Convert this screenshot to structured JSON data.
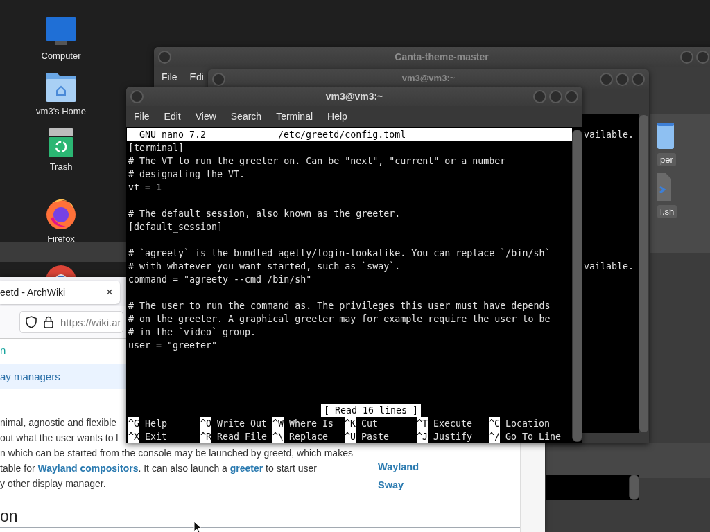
{
  "desktop_icons": [
    {
      "label": "Computer",
      "kind": "computer"
    },
    {
      "label": "vm3's Home",
      "kind": "home"
    },
    {
      "label": "Trash",
      "kind": "trash"
    },
    {
      "label": "Firefox",
      "kind": "firefox"
    },
    {
      "kind": "chrome"
    }
  ],
  "back_window": {
    "title": "Canta-theme-master",
    "menu": [
      "File",
      "Edi"
    ],
    "files": [
      {
        "label": "per",
        "kind": "folder"
      },
      {
        "label": "l.sh",
        "kind": "script"
      }
    ]
  },
  "middle_window": {
    "title": "vm3@vm3:~",
    "lines": [
      "vailable.",
      "vailable."
    ]
  },
  "browser": {
    "tab": {
      "title": "eetd - ArchWiki",
      "close": "×"
    },
    "url": "https://wiki.ar",
    "breadcrumb": "n",
    "category": "ay managers",
    "paragraph": [
      "nimal, agnostic and flexible",
      "out what the user wants to l",
      "n which can be started from the console may be launched by greetd, which makes",
      "table for **Wayland compositors**. It can also launch a **greeter** to start user",
      "y other display manager."
    ],
    "related": [
      "Wayland",
      "Sway"
    ],
    "heading": "on"
  },
  "terminal": {
    "title": "vm3@vm3:~",
    "menu": [
      "File",
      "Edit",
      "View",
      "Search",
      "Terminal",
      "Help"
    ],
    "nano": {
      "version": "GNU nano 7.2",
      "file": "/etc/greetd/config.toml",
      "lines": [
        {
          "kind": "code",
          "text": "[terminal]"
        },
        {
          "kind": "code",
          "text": "# The VT to run the greeter on. Can be \"next\", \"current\" or a number"
        },
        {
          "kind": "code",
          "text": "# designating the VT."
        },
        {
          "kind": "code",
          "text": "vt = 1"
        },
        {
          "kind": "blank"
        },
        {
          "kind": "code",
          "text": "# The default session, also known as the greeter."
        },
        {
          "kind": "code",
          "text": "[default_session]"
        },
        {
          "kind": "blank"
        },
        {
          "kind": "code",
          "text": "# `agreety` is the bundled agetty/login-lookalike. You can replace `/bin/sh`"
        },
        {
          "kind": "code",
          "text": "# with whatever you want started, such as `sway`."
        },
        {
          "kind": "code",
          "text": "command = \"agreety --cmd /bin/sh\""
        },
        {
          "kind": "blank"
        },
        {
          "kind": "code",
          "text": "# The user to run the command as. The privileges this user must have depends"
        },
        {
          "kind": "code",
          "text": "# on the greeter. A graphical greeter may for example require the user to be"
        },
        {
          "kind": "code",
          "text": "# in the `video` group."
        },
        {
          "kind": "code",
          "text": "user = \"greeter\""
        }
      ],
      "status": "[ Read 16 lines ]",
      "shortcuts": [
        [
          {
            "key": "^G",
            "label": "Help"
          },
          {
            "key": "^O",
            "label": "Write Out"
          },
          {
            "key": "^W",
            "label": "Where Is"
          },
          {
            "key": "^K",
            "label": "Cut"
          },
          {
            "key": "^T",
            "label": "Execute"
          },
          {
            "key": "^C",
            "label": "Location"
          }
        ],
        [
          {
            "key": "^X",
            "label": "Exit"
          },
          {
            "key": "^R",
            "label": "Read File"
          },
          {
            "key": "^\\",
            "label": "Replace"
          },
          {
            "key": "^U",
            "label": "Paste"
          },
          {
            "key": "^J",
            "label": "Justify"
          },
          {
            "key": "^/",
            "label": "Go To Line"
          }
        ]
      ]
    }
  }
}
